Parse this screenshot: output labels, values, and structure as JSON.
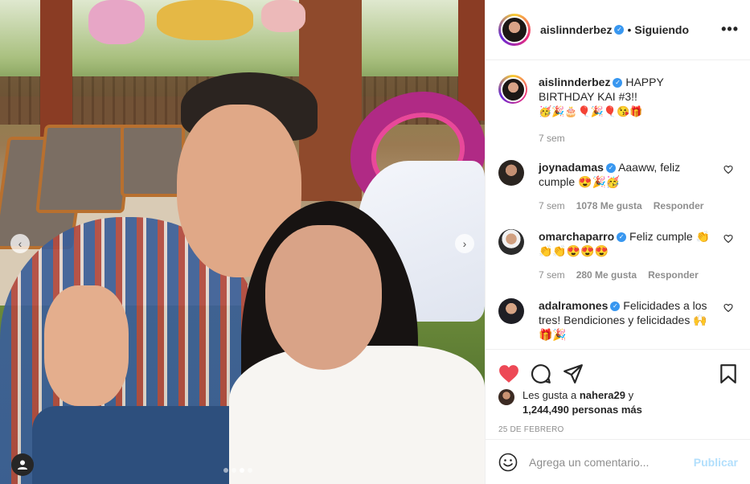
{
  "post": {
    "author": "aislinnderbez",
    "follow_status": "Siguiendo",
    "separator": "•",
    "more_label": "•••"
  },
  "photo": {
    "carousel_dots": 4,
    "active_dot": 2,
    "prev_glyph": "‹",
    "next_glyph": "›"
  },
  "caption": {
    "username": "aislinnderbez",
    "text": "HAPPY BIRTHDAY KAI #3!!",
    "emojis": "🥳🎉🎂🎈🎉🎈😘🎁",
    "time": "7 sem"
  },
  "comments": [
    {
      "username": "joynadamas",
      "verified": true,
      "text": "Aaaww, feliz cumple 😍🎉🥳",
      "time": "7 sem",
      "likes": "1078 Me gusta",
      "reply": "Responder"
    },
    {
      "username": "omarchaparro",
      "verified": true,
      "text": "Feliz cumple 👏👏👏😍😍😍",
      "time": "7 sem",
      "likes": "280 Me gusta",
      "reply": "Responder"
    },
    {
      "username": "adalramones",
      "verified": true,
      "text": "Felicidades a los tres! Bendiciones y felicidades 🙌🎁🎉",
      "time": "",
      "likes": "",
      "reply": ""
    }
  ],
  "likes": {
    "prefix": "Les gusta a",
    "user": "nahera29",
    "joiner": "y",
    "others": "1,244,490 personas más"
  },
  "date": "25 DE FEBRERO",
  "add_comment": {
    "placeholder": "Agrega un comentario...",
    "publish": "Publicar"
  },
  "icons": {
    "like": "heart-icon",
    "comment": "comment-icon",
    "share": "share-icon",
    "save": "bookmark-icon",
    "emoji": "emoji-icon",
    "tag": "user-tag-icon"
  },
  "colors": {
    "like_red": "#ed4956",
    "verified_blue": "#3897f0",
    "publish_disabled": "#b2dffc",
    "meta_gray": "#8e8e8e"
  }
}
